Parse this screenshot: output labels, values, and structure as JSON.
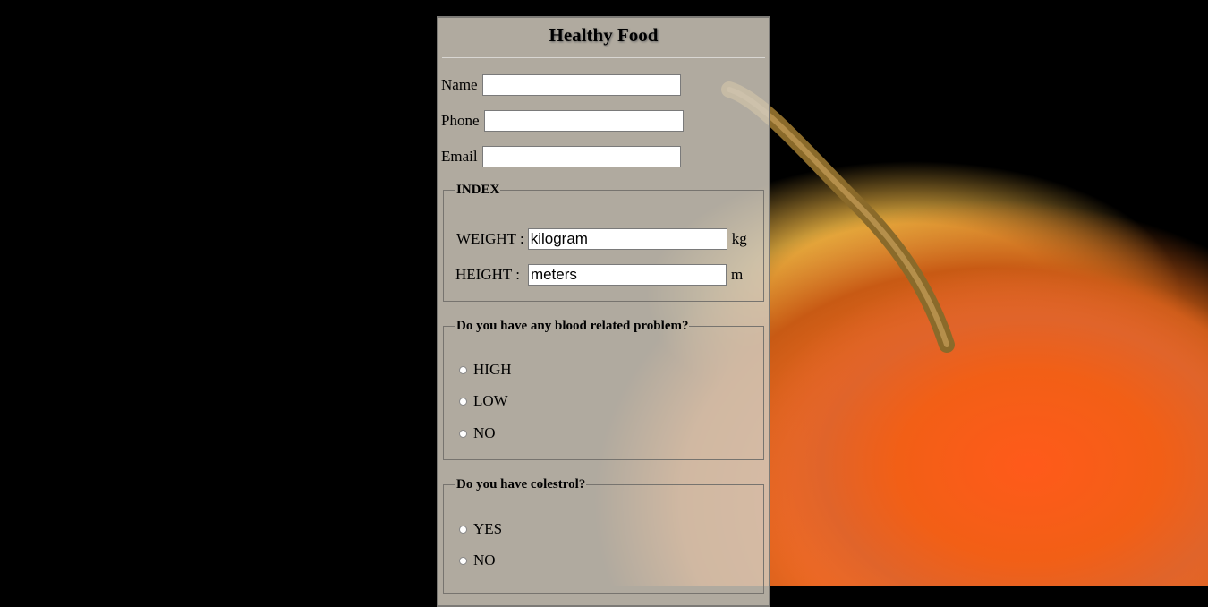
{
  "form": {
    "title": "Healthy Food",
    "name_label": "Name",
    "phone_label": "Phone",
    "email_label": "Email",
    "name_value": "",
    "phone_value": "",
    "email_value": ""
  },
  "index": {
    "legend": "INDEX",
    "weight_label": "WEIGHT :",
    "weight_value": "kilogram",
    "weight_unit": "kg",
    "height_label": "HEIGHT :",
    "height_value": "meters",
    "height_unit": "m"
  },
  "blood": {
    "legend": "Do you have any blood related problem?",
    "options": [
      "HIGH",
      "LOW",
      "NO"
    ]
  },
  "colestrol": {
    "legend": "Do you have colestrol?",
    "options": [
      "YES",
      "NO"
    ]
  },
  "colors": {
    "panel_bg": "#d2cabe",
    "apple": "#f25f16"
  }
}
